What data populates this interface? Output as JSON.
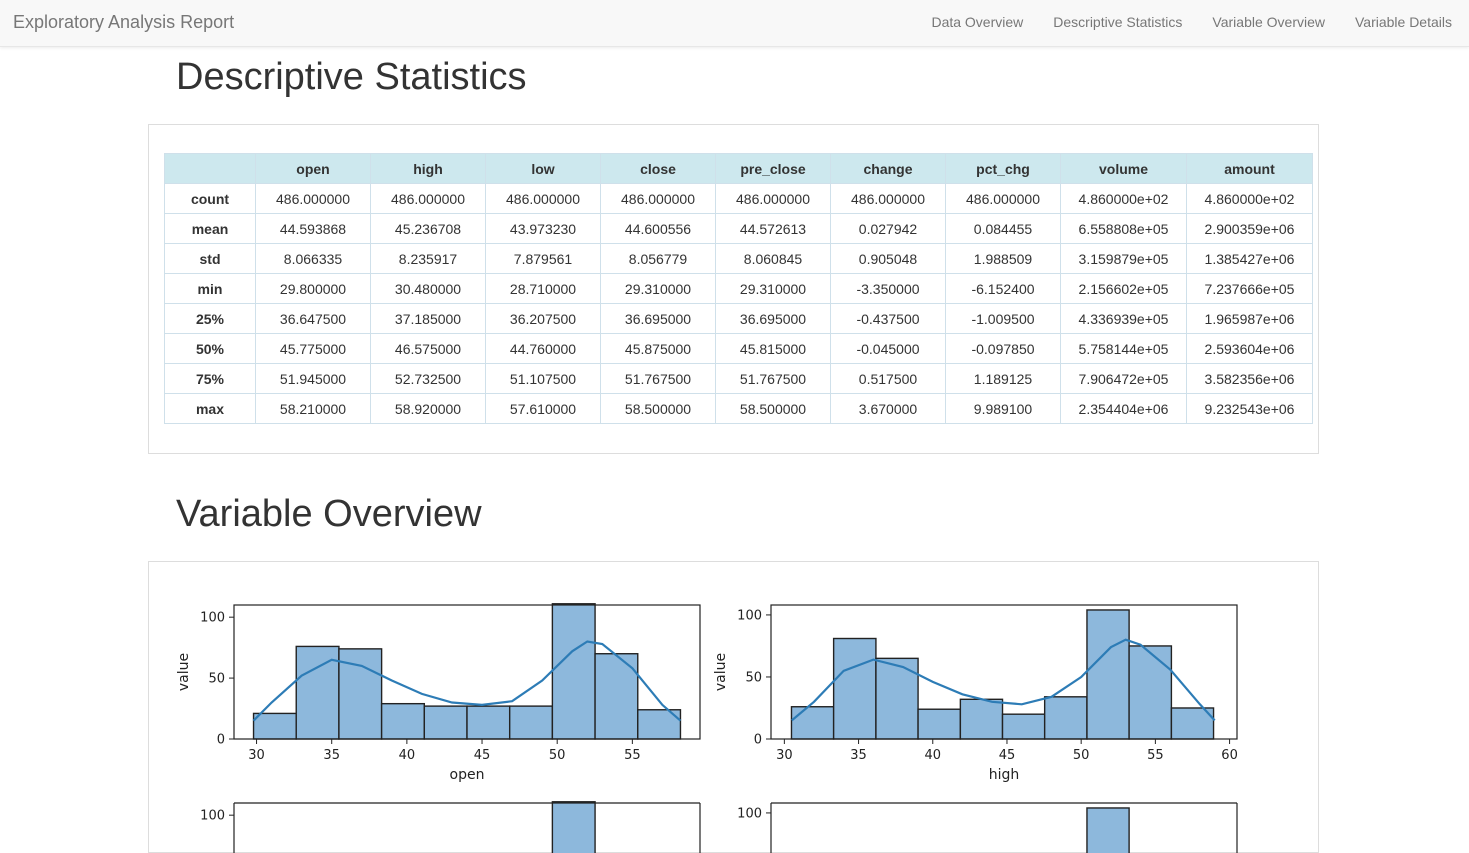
{
  "navbar": {
    "brand": "Exploratory Analysis Report",
    "links": [
      "Data Overview",
      "Descriptive Statistics",
      "Variable Overview",
      "Variable Details"
    ]
  },
  "sections": {
    "descriptive": "Descriptive Statistics",
    "variable_overview": "Variable Overview"
  },
  "stats_table": {
    "columns": [
      "",
      "open",
      "high",
      "low",
      "close",
      "pre_close",
      "change",
      "pct_chg",
      "volume",
      "amount"
    ],
    "rows": [
      [
        "count",
        "486.000000",
        "486.000000",
        "486.000000",
        "486.000000",
        "486.000000",
        "486.000000",
        "486.000000",
        "4.860000e+02",
        "4.860000e+02"
      ],
      [
        "mean",
        "44.593868",
        "45.236708",
        "43.973230",
        "44.600556",
        "44.572613",
        "0.027942",
        "0.084455",
        "6.558808e+05",
        "2.900359e+06"
      ],
      [
        "std",
        "8.066335",
        "8.235917",
        "7.879561",
        "8.056779",
        "8.060845",
        "0.905048",
        "1.988509",
        "3.159879e+05",
        "1.385427e+06"
      ],
      [
        "min",
        "29.800000",
        "30.480000",
        "28.710000",
        "29.310000",
        "29.310000",
        "-3.350000",
        "-6.152400",
        "2.156602e+05",
        "7.237666e+05"
      ],
      [
        "25%",
        "36.647500",
        "37.185000",
        "36.207500",
        "36.695000",
        "36.695000",
        "-0.437500",
        "-1.009500",
        "4.336939e+05",
        "1.965987e+06"
      ],
      [
        "50%",
        "45.775000",
        "46.575000",
        "44.760000",
        "45.875000",
        "45.815000",
        "-0.045000",
        "-0.097850",
        "5.758144e+05",
        "2.593604e+06"
      ],
      [
        "75%",
        "51.945000",
        "52.732500",
        "51.107500",
        "51.767500",
        "51.767500",
        "0.517500",
        "1.189125",
        "7.906472e+05",
        "3.582356e+06"
      ],
      [
        "max",
        "58.210000",
        "58.920000",
        "57.610000",
        "58.500000",
        "58.500000",
        "3.670000",
        "9.989100",
        "2.354404e+06",
        "9.232543e+06"
      ]
    ]
  },
  "colors": {
    "bar": "#8db8dc",
    "kde": "#2d7cb6",
    "header_bg": "#cde8ee"
  },
  "chart_data": [
    {
      "type": "bar",
      "xlabel": "open",
      "ylabel": "value",
      "xlim": [
        28.5,
        59.5
      ],
      "ylim": [
        0,
        110
      ],
      "xticks": [
        "30",
        "35",
        "40",
        "45",
        "50",
        "55"
      ],
      "yticks": [
        "0",
        "50",
        "100"
      ],
      "bin_edges": [
        29.8,
        32.64,
        35.48,
        38.32,
        41.16,
        44.0,
        46.84,
        49.68,
        52.52,
        55.36,
        58.2
      ],
      "values": [
        21,
        76,
        74,
        29,
        27,
        27,
        27,
        111,
        70,
        24
      ],
      "kde": [
        [
          29.8,
          15
        ],
        [
          31,
          30
        ],
        [
          33,
          52
        ],
        [
          35,
          65
        ],
        [
          37,
          60
        ],
        [
          39,
          48
        ],
        [
          41,
          37
        ],
        [
          43,
          30
        ],
        [
          45,
          28
        ],
        [
          47,
          31
        ],
        [
          49,
          48
        ],
        [
          51,
          72
        ],
        [
          52,
          80
        ],
        [
          53,
          78
        ],
        [
          55,
          58
        ],
        [
          57,
          28
        ],
        [
          58.2,
          15
        ]
      ]
    },
    {
      "type": "bar",
      "xlabel": "high",
      "ylabel": "value",
      "xlim": [
        29.1,
        60.5
      ],
      "ylim": [
        0,
        108
      ],
      "xticks": [
        "30",
        "35",
        "40",
        "45",
        "50",
        "55",
        "60"
      ],
      "yticks": [
        "0",
        "50",
        "100"
      ],
      "bin_edges": [
        30.48,
        33.32,
        36.17,
        39.01,
        41.86,
        44.7,
        47.54,
        50.39,
        53.23,
        56.08,
        58.92
      ],
      "values": [
        26,
        81,
        65,
        24,
        32,
        20,
        34,
        104,
        75,
        25
      ],
      "kde": [
        [
          30.5,
          15
        ],
        [
          32,
          30
        ],
        [
          34,
          55
        ],
        [
          36,
          64
        ],
        [
          38,
          58
        ],
        [
          40,
          46
        ],
        [
          42,
          36
        ],
        [
          44,
          30
        ],
        [
          46,
          28
        ],
        [
          48,
          34
        ],
        [
          50,
          50
        ],
        [
          52,
          74
        ],
        [
          53,
          80
        ],
        [
          54,
          76
        ],
        [
          56,
          56
        ],
        [
          58,
          28
        ],
        [
          59,
          15
        ]
      ]
    },
    {
      "type": "bar",
      "xlabel": "",
      "ylabel": "",
      "ylim": [
        0,
        110
      ],
      "yticks": [
        "100"
      ],
      "note": "partially visible (cut off at bottom)"
    },
    {
      "type": "bar",
      "xlabel": "",
      "ylabel": "",
      "ylim": [
        0,
        108
      ],
      "yticks": [
        "100"
      ],
      "note": "partially visible (cut off at bottom)"
    }
  ]
}
